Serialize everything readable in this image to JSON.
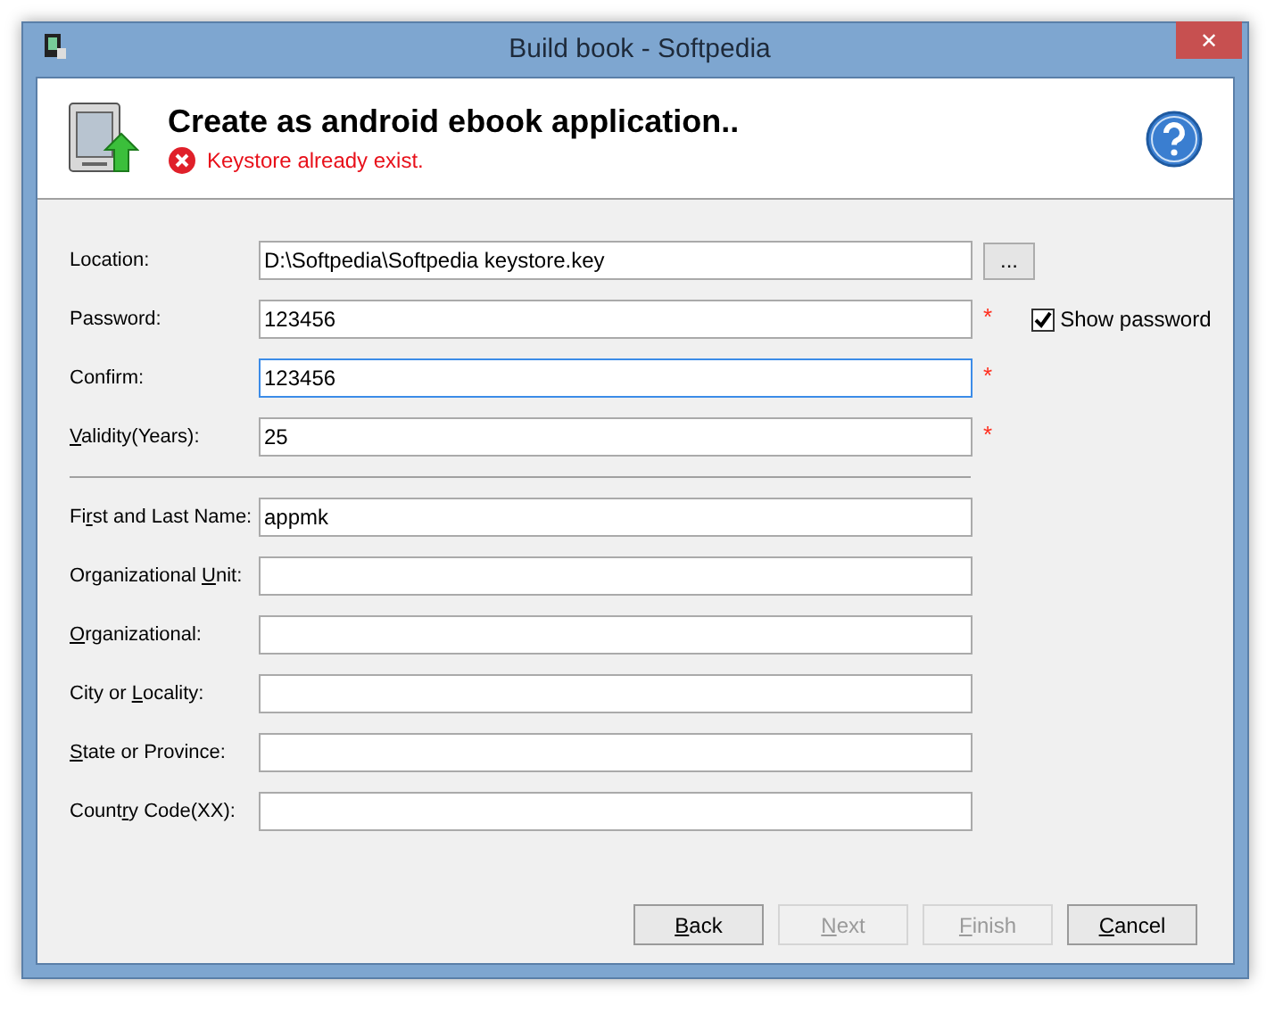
{
  "window": {
    "title": "Build book - Softpedia",
    "close": "✕"
  },
  "header": {
    "title": "Create as android ebook application..",
    "error": "Keystore already exist."
  },
  "fields": [
    {
      "label": {
        "before": "Location:"
      },
      "value": "D:\\Softpedia\\Softpedia keystore.key",
      "focused": false,
      "browse": "..."
    },
    {
      "label": {
        "before": "Password:"
      },
      "value": "123456",
      "focused": false,
      "required_mark": "*",
      "show_password": {
        "label": "Show password",
        "checked": true
      }
    },
    {
      "label": {
        "before": "Confirm:"
      },
      "value": "123456",
      "focused": true,
      "required_mark": "*"
    },
    {
      "label": {
        "key": "V",
        "after": "alidity(Years):"
      },
      "value": "25",
      "focused": false,
      "required_mark": "*",
      "separator_after": true
    },
    {
      "label": {
        "before": "Fi",
        "key": "r",
        "after": "st and Last Name:"
      },
      "value": "appmk",
      "focused": false
    },
    {
      "label": {
        "before": "Organizational ",
        "key": "U",
        "after": "nit:"
      },
      "focused": false
    },
    {
      "label": {
        "key": "O",
        "after": "rganizational:"
      },
      "focused": false
    },
    {
      "label": {
        "before": "City or ",
        "key": "L",
        "after": "ocality:"
      },
      "focused": false
    },
    {
      "label": {
        "key": "S",
        "after": "tate or Province:"
      },
      "focused": false
    },
    {
      "label": {
        "before": "Count",
        "key": "r",
        "after": "y Code(XX):"
      },
      "focused": false
    }
  ],
  "buttons": [
    {
      "label": {
        "key": "B",
        "after": "ack"
      },
      "disabled": false
    },
    {
      "label": {
        "key": "N",
        "after": "ext"
      },
      "disabled": true
    },
    {
      "label": {
        "key": "F",
        "after": "inish"
      },
      "disabled": true
    },
    {
      "label": {
        "key": "C",
        "after": "ancel"
      },
      "disabled": false
    }
  ]
}
